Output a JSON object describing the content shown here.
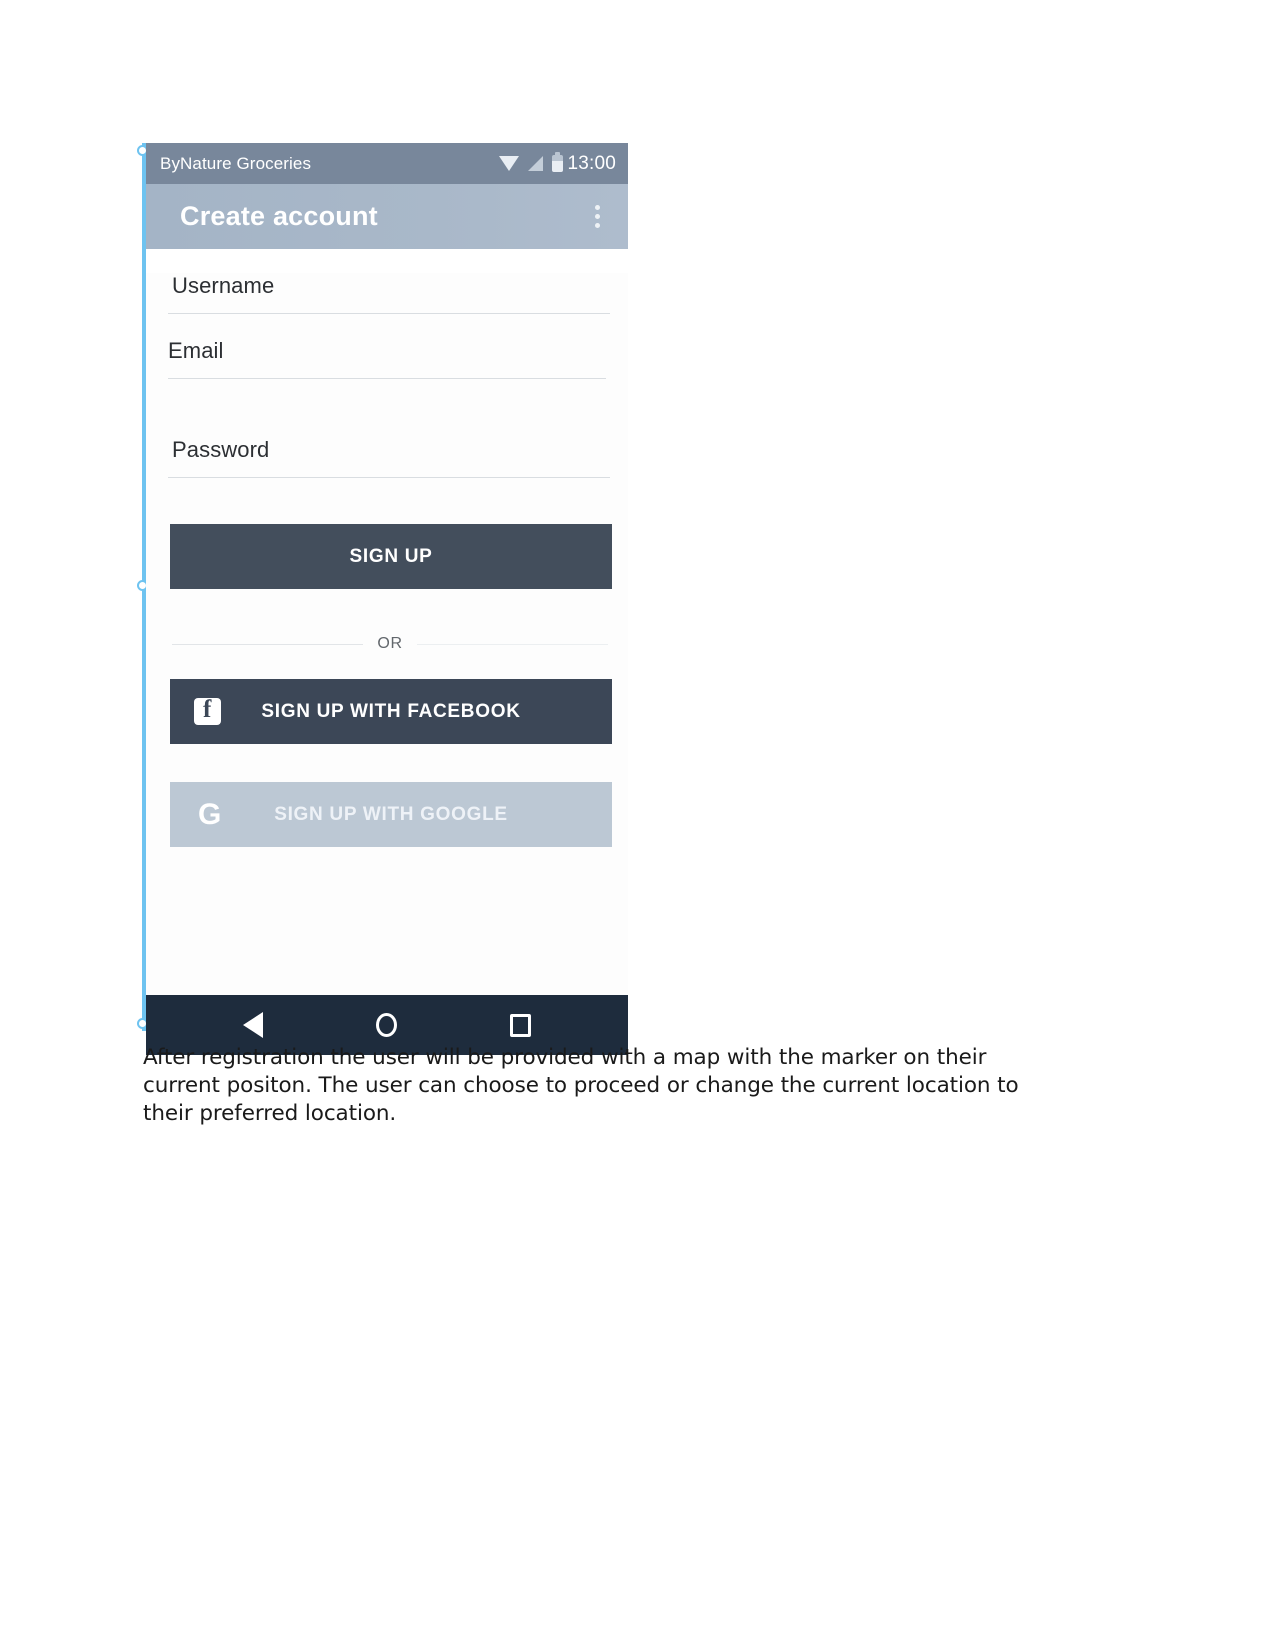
{
  "document": {
    "caption": "After registration the user will be provided with a map with the marker on their current positon. The user can choose to proceed or change the current location to their preferred location."
  },
  "phone": {
    "status_bar": {
      "app_name": "ByNature Groceries",
      "time": "13:00",
      "icons": [
        "wifi-icon",
        "signal-icon",
        "battery-icon"
      ],
      "background_color": "#78879b"
    },
    "app_bar": {
      "title": "Create account",
      "overflow_menu": "overflow-menu-icon",
      "background_color": "#a9b8c9"
    },
    "form": {
      "fields": [
        {
          "name": "username",
          "label": "Username",
          "value": "",
          "placeholder": "Username"
        },
        {
          "name": "email",
          "label": "Email",
          "value": "",
          "placeholder": "Email"
        },
        {
          "name": "password",
          "label": "Password",
          "value": "",
          "placeholder": "Password"
        }
      ],
      "primary_button": {
        "label": "SIGN UP",
        "color": "#434e5c"
      },
      "divider_label": "OR",
      "social_buttons": [
        {
          "name": "facebook",
          "label": "SIGN UP WITH FACEBOOK",
          "icon": "facebook-icon",
          "color": "#3c4757",
          "enabled": true
        },
        {
          "name": "google",
          "label": "SIGN UP WITH GOOGLE",
          "icon": "google-icon",
          "color": "#bcc8d4",
          "enabled": false
        }
      ]
    },
    "nav_bar": {
      "background_color": "#1e2c3d",
      "buttons": [
        {
          "name": "back",
          "icon": "back-triangle-icon"
        },
        {
          "name": "home",
          "icon": "home-circle-icon"
        },
        {
          "name": "recents",
          "icon": "recents-square-icon"
        }
      ]
    }
  },
  "selection": {
    "border_color": "#6ec3f0"
  }
}
